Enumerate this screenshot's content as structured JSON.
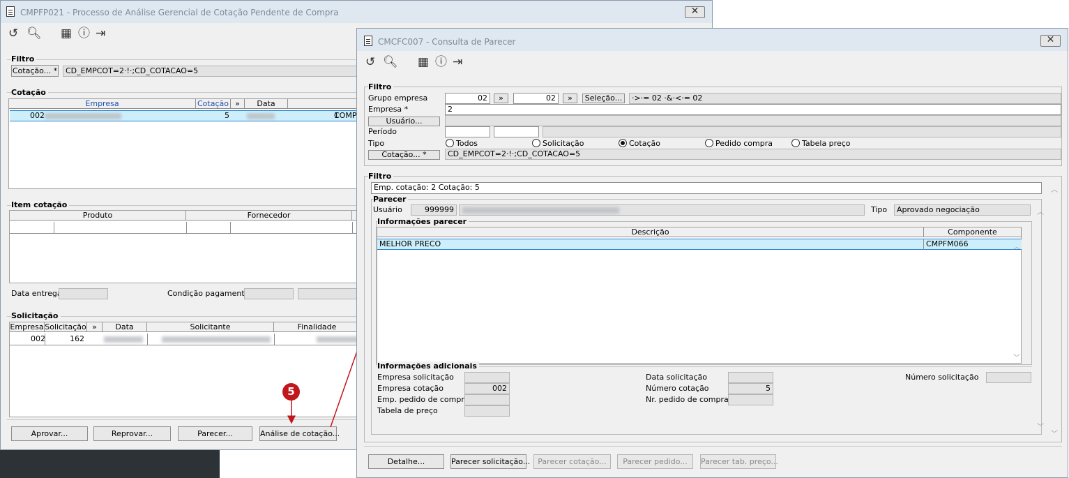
{
  "back_window": {
    "title": "CMPFP021 - Processo de Análise Gerencial de Cotação Pendente de Compra",
    "filtro": {
      "title": "Filtro",
      "cotacao_button": "Cotação... *",
      "cotacao_value": "CD_EMPCOT=2·!·;CD_COTACAO=5"
    },
    "cotacao": {
      "title": "Cotação",
      "headers": [
        "Empresa",
        "Cotação",
        "»",
        "Data"
      ],
      "row": {
        "empresa": "002",
        "cotacao": "5",
        "count": "1",
        "extra": "COMPR"
      }
    },
    "item_cotacao": {
      "title": "Item cotação",
      "headers": [
        "Produto",
        "Fornecedor"
      ],
      "data_entrega_label": "Data entrega",
      "condicao_pagamento_label": "Condição pagamento"
    },
    "solicitacao": {
      "title": "Solicitação",
      "headers": [
        "Empresa",
        "Solicitação",
        "»",
        "Data",
        "Solicitante",
        "Finalidade"
      ],
      "row": {
        "empresa": "002",
        "solicitacao": "162"
      }
    },
    "buttons": {
      "aprovar": "Aprovar...",
      "reprovar": "Reprovar...",
      "parecer": "Parecer...",
      "analise": "Análise de cotação..."
    }
  },
  "step_marker": "5",
  "front_window": {
    "title": "CMCFC007 - Consulta de Parecer",
    "filtro": {
      "title": "Filtro",
      "grupo_empresa_label": "Grupo empresa",
      "grupo_from": "02",
      "grupo_to": "02",
      "more_label": "»",
      "selecao_button": "Seleção...",
      "selecao_value": "·>·= 02 ·&·<·= 02",
      "empresa_label": "Empresa *",
      "empresa_value": "2",
      "usuario_button": "Usuário...",
      "periodo_label": "Período",
      "tipo_label": "Tipo",
      "tipo_options": [
        "Todos",
        "Solicitação",
        "Cotação",
        "Pedido compra",
        "Tabela preço"
      ],
      "tipo_selected": "Cotação",
      "cotacao_button": "Cotação... *",
      "cotacao_value": "CD_EMPCOT=2·!·;CD_COTACAO=5"
    },
    "filtro2": {
      "title": "Filtro",
      "summary": "Emp. cotação: 2  Cotação: 5"
    },
    "parecer": {
      "title": "Parecer",
      "usuario_label": "Usuário",
      "usuario_code": "999999",
      "tipo_label": "Tipo",
      "tipo_value": "Aprovado negociação"
    },
    "informacoes_parecer": {
      "title": "Informações parecer",
      "headers": [
        "Descrição",
        "Componente"
      ],
      "rows": [
        {
          "descricao": "MELHOR PRECO",
          "componente": "CMPFM066"
        }
      ]
    },
    "informacoes_adicionais": {
      "title": "Informações adicionais",
      "empresa_solicitacao_label": "Empresa solicitação",
      "empresa_cotacao_label": "Empresa cotação",
      "empresa_cotacao_value": "002",
      "emp_pedido_label": "Emp. pedido de compra",
      "tabela_preco_label": "Tabela de preço",
      "data_solicitacao_label": "Data solicitação",
      "numero_cotacao_label": "Número cotação",
      "numero_cotacao_value": "5",
      "nr_pedido_label": "Nr. pedido de compra",
      "numero_solicitacao_label": "Número solicitação"
    },
    "buttons": {
      "detalhe": "Detalhe...",
      "parecer_solicitacao": "Parecer solicitação...",
      "parecer_cotacao": "Parecer cotação...",
      "parecer_pedido": "Parecer pedido...",
      "parecer_tab_preco": "Parecer tab. preço..."
    }
  }
}
